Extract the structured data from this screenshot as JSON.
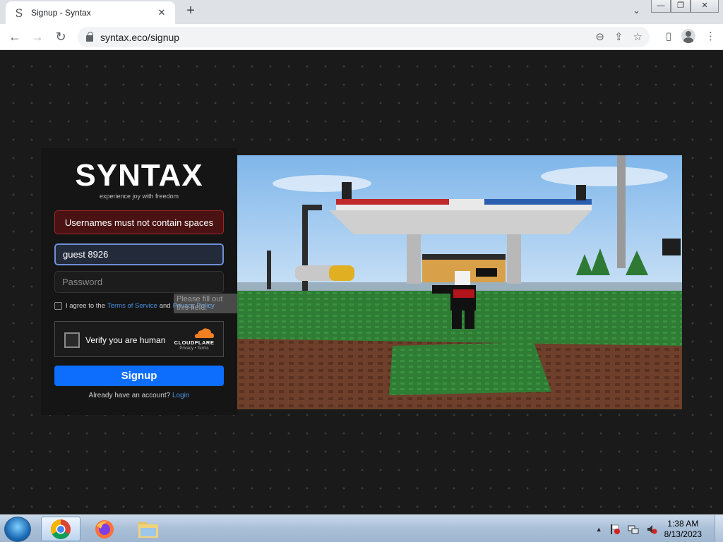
{
  "browser": {
    "tab": {
      "title": "Signup - Syntax",
      "favicon": "S",
      "close": "✕"
    },
    "new_tab": "+",
    "tab_search": "⌄",
    "window_controls": [
      "—",
      "❐",
      "✕"
    ],
    "nav": {
      "back": "←",
      "forward": "→",
      "reload": "↻"
    },
    "url": "syntax.eco/signup",
    "omnibox_icons": [
      "⊖",
      "⇪",
      "☆"
    ],
    "toolbar_icons": {
      "side_panel": "▯",
      "menu": "⋮"
    }
  },
  "signup": {
    "logo": "SYNTAX",
    "tagline": "experience joy with freedom",
    "error": "Usernames must not contain spaces",
    "username_value": "guest 8926",
    "password_placeholder": "Password",
    "tos_prefix": "I agree to the",
    "tos_link": "Terms of Service",
    "tos_and": "and",
    "privacy_link": "Privacy Policy",
    "tooltip": "Please fill out this field.",
    "captcha_label": "Verify you are human",
    "cloudflare_word": "CLOUDFLARE",
    "cloudflare_links": "Privacy • Terms",
    "button": "Signup",
    "login_prefix": "Already have an account?",
    "login_link": "Login"
  },
  "taskbar": {
    "time": "1:38 AM",
    "date": "8/13/2023",
    "tray_arrow": "▲"
  },
  "colors": {
    "accent": "#0d6efd",
    "error_bg": "#4a1212",
    "link": "#4a90e2"
  }
}
